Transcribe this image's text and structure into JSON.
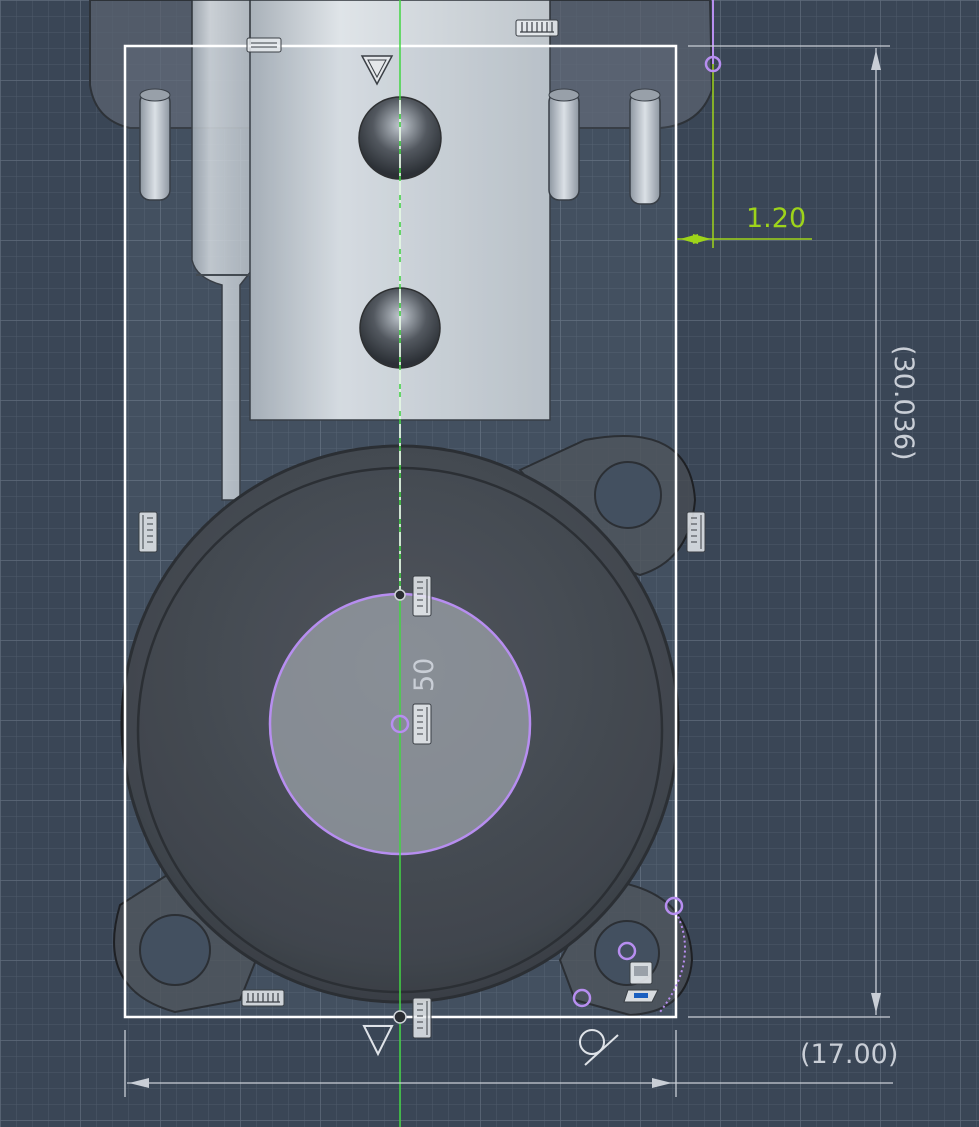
{
  "sketch": {
    "dimensions": {
      "offset": "1.20",
      "height_reference": "(30.036)",
      "width_reference": "(17.00)",
      "circle_diameter": "50"
    }
  },
  "colors": {
    "background": "#3a4656",
    "grid_minor": "#4e5a6a",
    "grid_major": "#5c6878",
    "sketch_line": "#ffffff",
    "dimension_active": "#9ed41a",
    "dimension_reference": "#c9ced6",
    "selection": "#b78ef0",
    "axis": "#42d642"
  }
}
